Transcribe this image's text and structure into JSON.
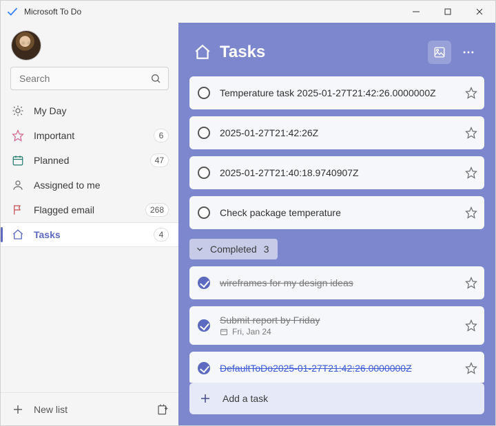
{
  "app": {
    "title": "Microsoft To Do"
  },
  "search": {
    "placeholder": "Search"
  },
  "sidebar": {
    "items": [
      {
        "icon": "sun",
        "label": "My Day",
        "count": null,
        "active": false
      },
      {
        "icon": "star",
        "label": "Important",
        "count": "6",
        "active": false
      },
      {
        "icon": "calendar",
        "label": "Planned",
        "count": "47",
        "active": false
      },
      {
        "icon": "person",
        "label": "Assigned to me",
        "count": null,
        "active": false
      },
      {
        "icon": "flag",
        "label": "Flagged email",
        "count": "268",
        "active": false
      },
      {
        "icon": "home",
        "label": "Tasks",
        "count": "4",
        "active": true
      }
    ],
    "newList": "New list"
  },
  "main": {
    "title": "Tasks",
    "completedHeader": "Completed",
    "completedCount": "3",
    "tasks": [
      {
        "title": "Temperature task 2025-01-27T21:42:26.0000000Z",
        "done": false
      },
      {
        "title": "2025-01-27T21:42:26Z",
        "done": false
      },
      {
        "title": "2025-01-27T21:40:18.9740907Z",
        "done": false
      },
      {
        "title": "Check package temperature",
        "done": false
      }
    ],
    "completedTasks": [
      {
        "title": "wireframes for my design ideas",
        "done": true,
        "link": false
      },
      {
        "title": "Submit report by Friday",
        "done": true,
        "link": false,
        "dueLabel": "Fri, Jan 24"
      },
      {
        "title": "DefaultToDo2025-01-27T21:42:26.0000000Z",
        "done": true,
        "link": true
      }
    ],
    "addTask": "Add a task"
  }
}
